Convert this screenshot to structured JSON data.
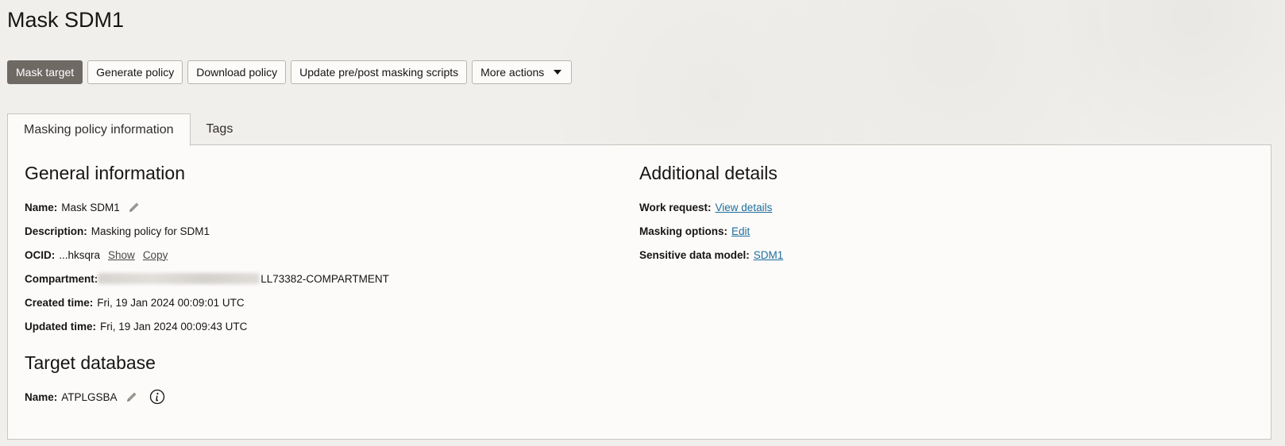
{
  "page": {
    "title": "Mask SDM1"
  },
  "toolbar": {
    "mask_target": "Mask target",
    "generate_policy": "Generate policy",
    "download_policy": "Download policy",
    "update_scripts": "Update pre/post masking scripts",
    "more_actions": "More actions"
  },
  "tabs": [
    {
      "label": "Masking policy information",
      "active": true
    },
    {
      "label": "Tags",
      "active": false
    }
  ],
  "general": {
    "title": "General information",
    "name_label": "Name:",
    "name_value": "Mask SDM1",
    "description_label": "Description:",
    "description_value": "Masking policy for SDM1",
    "ocid_label": "OCID:",
    "ocid_value": "...hksqra",
    "ocid_show": "Show",
    "ocid_copy": "Copy",
    "compartment_label": "Compartment:",
    "compartment_value": "LL73382-COMPARTMENT",
    "created_label": "Created time:",
    "created_value": "Fri, 19 Jan 2024 00:09:01 UTC",
    "updated_label": "Updated time:",
    "updated_value": "Fri, 19 Jan 2024 00:09:43 UTC"
  },
  "target": {
    "title": "Target database",
    "name_label": "Name:",
    "name_value": "ATPLGSBA"
  },
  "additional": {
    "title": "Additional details",
    "work_request_label": "Work request:",
    "work_request_link": "View details",
    "masking_options_label": "Masking options:",
    "masking_options_link": "Edit",
    "sdm_label": "Sensitive data model:",
    "sdm_link": "SDM1"
  },
  "colors": {
    "primary_button": "#6f6964",
    "link": "#1f6e9b",
    "background": "#f1efec",
    "panel": "#fcfbfa"
  }
}
